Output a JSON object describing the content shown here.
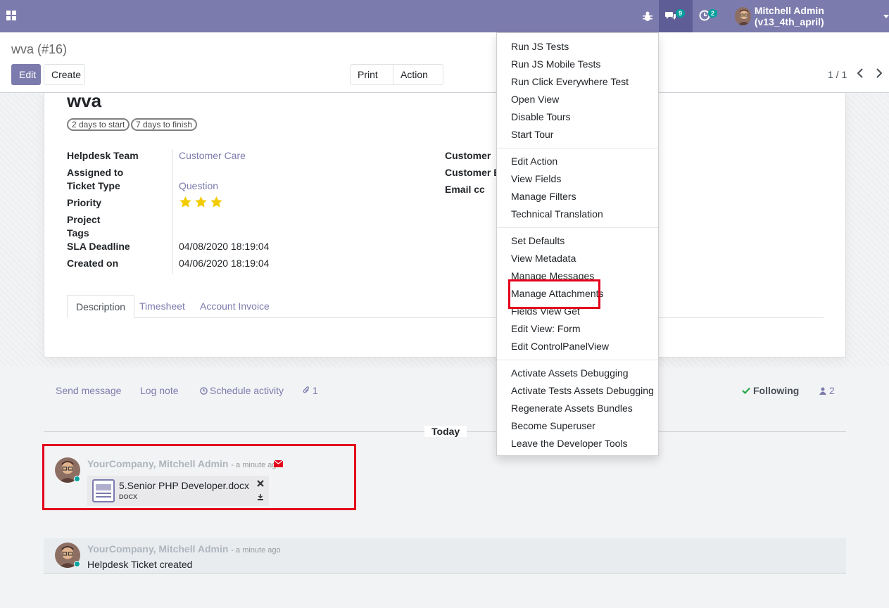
{
  "navbar": {
    "chat_count": "9",
    "activity_count": "2",
    "user_name": "Mitchell Admin (v13_4th_april)"
  },
  "control_panel": {
    "breadcrumb": "wva (#16)",
    "edit_label": "Edit",
    "create_label": "Create",
    "print_label": "Print",
    "action_label": "Action",
    "pager": "1 / 1"
  },
  "form": {
    "title": "wva",
    "tags": [
      "2 days to start",
      "7 days to finish"
    ],
    "labels": {
      "team": "Helpdesk Team",
      "assigned": "Assigned to",
      "ticket_type": "Ticket Type",
      "priority": "Priority",
      "project": "Project",
      "tags": "Tags",
      "sla": "SLA Deadline",
      "created": "Created on",
      "customer": "Customer",
      "customer_email": "Customer E",
      "email_cc": "Email cc"
    },
    "values": {
      "team": "Customer Care",
      "ticket_type": "Question",
      "sla": "04/08/2020 18:19:04",
      "created": "04/06/2020 18:19:04"
    },
    "priority_stars": 3,
    "tabs": [
      "Description",
      "Timesheet",
      "Account Invoice"
    ]
  },
  "chatter": {
    "send_message": "Send message",
    "log_note": "Log note",
    "schedule_activity": "Schedule activity",
    "attachments_count": "1",
    "following": "Following",
    "followers_count": "2",
    "today": "Today",
    "messages": [
      {
        "author": "YourCompany, Mitchell Admin",
        "date": "- a minute ago",
        "attachment_name": "5.Senior PHP Developer.docx",
        "attachment_ext": "DOCX"
      },
      {
        "author": "YourCompany, Mitchell Admin",
        "date": "- a minute ago",
        "body": "Helpdesk Ticket created"
      }
    ]
  },
  "debug_menu": {
    "groups": [
      [
        "Run JS Tests",
        "Run JS Mobile Tests",
        "Run Click Everywhere Test",
        "Open View",
        "Disable Tours",
        "Start Tour"
      ],
      [
        "Edit Action",
        "View Fields",
        "Manage Filters",
        "Technical Translation"
      ],
      [
        "Set Defaults",
        "View Metadata",
        "Manage Messages",
        "Manage Attachments",
        "Fields View Get",
        "Edit View: Form",
        "Edit ControlPanelView"
      ],
      [
        "Activate Assets Debugging",
        "Activate Tests Assets Debugging",
        "Regenerate Assets Bundles",
        "Become Superuser",
        "Leave the Developer Tools"
      ]
    ]
  },
  "colors": {
    "brand": "#7c7bad",
    "highlight": "#e3001b",
    "online": "#00a09d"
  }
}
